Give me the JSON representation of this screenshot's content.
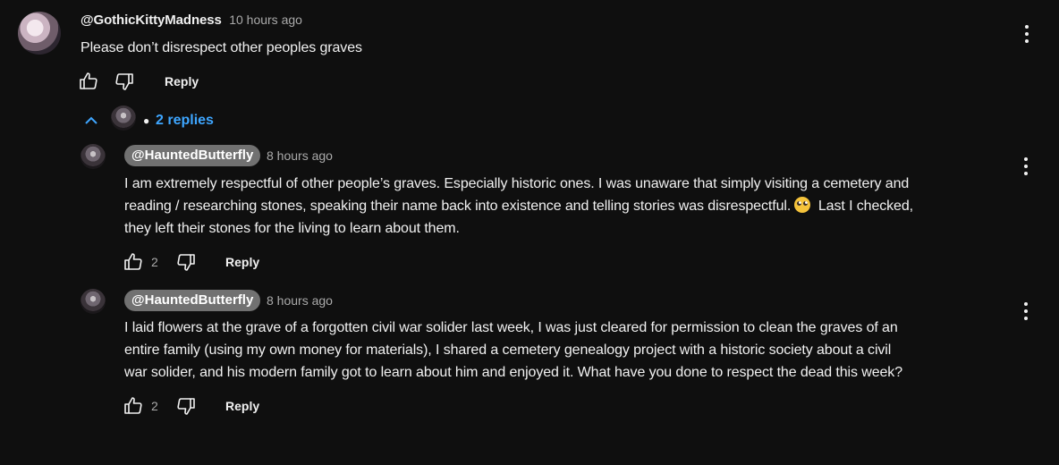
{
  "comment": {
    "handle": "@GothicKittyMadness",
    "time": "10 hours ago",
    "text": "Please don’t disrespect other peoples graves",
    "reply_label": "Reply",
    "replies_toggle": "2 replies"
  },
  "replies": [
    {
      "handle": "@HauntedButterfly",
      "time": "8 hours ago",
      "text_lines": [
        "I am extremely respectful of other people’s graves. Especially historic ones. I was unaware that simply visiting a cemetery and",
        "reading / researching stones, speaking their name back into existence and telling stories was disrespectful.",
        "Last I checked,",
        "they left their stones for the living to learn about them."
      ],
      "emoji": "face-with-rolling-eyes-emoji",
      "likes": "2",
      "reply_label": "Reply"
    },
    {
      "handle": "@HauntedButterfly",
      "time": "8 hours ago",
      "text_lines": [
        "I laid flowers at the grave of a forgotten civil war solider last week, I was just cleared for permission to clean the graves of an",
        "entire family (using my own money for materials), I shared a cemetery genealogy project with a historic society about a civil",
        "war solider, and his modern family got to learn about him and enjoyed it. What have you done to respect the dead this week?"
      ],
      "likes": "2",
      "reply_label": "Reply"
    }
  ],
  "icons": {
    "like": "thumbs-up-icon",
    "dislike": "thumbs-down-icon",
    "more": "more-vert-icon",
    "collapse": "chevron-up-icon"
  },
  "colors": {
    "background": "#0f0f0f",
    "link": "#3ea6ff",
    "handle_pill": "#717171",
    "secondary_text": "#aaaaaa"
  }
}
